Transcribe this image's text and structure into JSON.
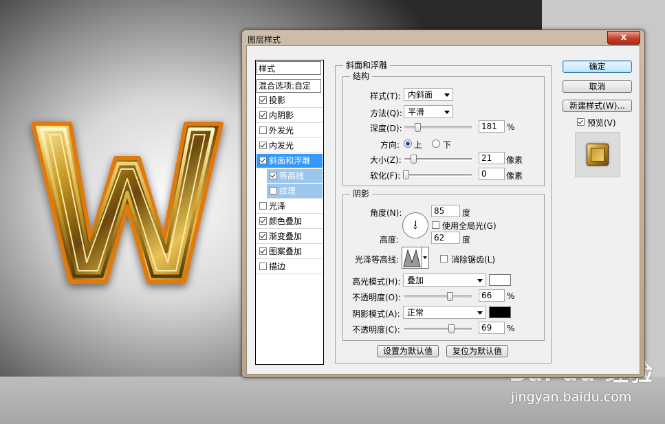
{
  "dialog": {
    "title": "图层样式",
    "close_label": "x"
  },
  "style_list": {
    "header": "样式",
    "blending_options": "混合选项:自定",
    "items": [
      {
        "label": "投影",
        "checked": true
      },
      {
        "label": "内阴影",
        "checked": true
      },
      {
        "label": "外发光",
        "checked": false
      },
      {
        "label": "内发光",
        "checked": true
      },
      {
        "label": "斜面和浮雕",
        "checked": true,
        "selected": true
      },
      {
        "label": "等高线",
        "checked": true,
        "sub": true
      },
      {
        "label": "纹理",
        "checked": false,
        "sub": true
      },
      {
        "label": "光泽",
        "checked": false
      },
      {
        "label": "颜色叠加",
        "checked": true
      },
      {
        "label": "渐变叠加",
        "checked": true
      },
      {
        "label": "图案叠加",
        "checked": true
      },
      {
        "label": "描边",
        "checked": false
      }
    ]
  },
  "bevel": {
    "section_title": "斜面和浮雕",
    "structure_title": "结构",
    "style_label": "样式(T):",
    "style_value": "内斜面",
    "technique_label": "方法(Q):",
    "technique_value": "平滑",
    "depth_label": "深度(D):",
    "depth_value": "181",
    "depth_unit": "%",
    "direction_label": "方向:",
    "direction_up": "上",
    "direction_down": "下",
    "size_label": "大小(Z):",
    "size_value": "21",
    "size_unit": "像素",
    "soften_label": "软化(F):",
    "soften_value": "0",
    "soften_unit": "像素"
  },
  "shading": {
    "title": "阴影",
    "angle_label": "角度(N):",
    "angle_value": "85",
    "angle_unit": "度",
    "global_light_label": "使用全局光(G)",
    "altitude_label": "高度:",
    "altitude_value": "62",
    "altitude_unit": "度",
    "gloss_contour_label": "光泽等高线:",
    "antialias_label": "消除锯齿(L)",
    "highlight_mode_label": "高光模式(H):",
    "highlight_mode_value": "叠加",
    "highlight_color": "#ffffff",
    "highlight_opacity_label": "不透明度(O):",
    "highlight_opacity_value": "66",
    "highlight_opacity_unit": "%",
    "shadow_mode_label": "阴影模式(A):",
    "shadow_mode_value": "正常",
    "shadow_color": "#000000",
    "shadow_opacity_label": "不透明度(C):",
    "shadow_opacity_value": "69",
    "shadow_opacity_unit": "%"
  },
  "buttons": {
    "make_default": "设置为默认值",
    "reset_default": "复位为默认值",
    "ok": "确定",
    "cancel": "取消",
    "new_style": "新建样式(W)...",
    "preview_label": "预览(V)"
  },
  "watermark": {
    "logo": "Bai du 经验",
    "sub": "jingyan.baidu.com"
  },
  "colors": {
    "accent_selected": "#3399ff",
    "default_button": "#bde6fd",
    "gold": "#d4a52a"
  }
}
